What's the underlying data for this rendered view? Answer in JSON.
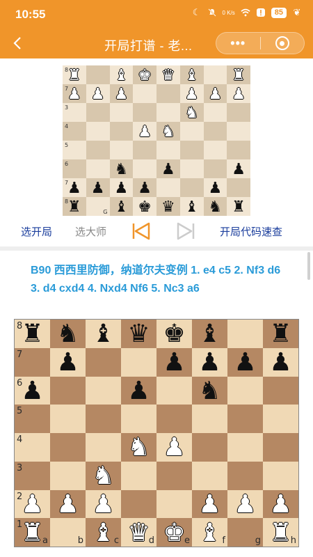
{
  "status_bar": {
    "time": "10:55",
    "net_speed": "0 K/s",
    "battery": "85",
    "icons": [
      "moon-icon",
      "mute-icon",
      "wifi-icon",
      "alert-icon",
      "battery-icon",
      "leaf-icon"
    ]
  },
  "navbar": {
    "title": "开局打谱 - 老...",
    "back_icon": "chevron-left-icon",
    "more_label": "•••",
    "target_icon": "target-icon",
    "background": "#f0952a"
  },
  "toolbar": {
    "select_opening": "选开局",
    "select_master": "选大师",
    "prev_icon": "skip-back-icon",
    "next_icon": "skip-forward-icon",
    "opening_code_lookup": "开局代码速查",
    "accent_prev": "#f0952a"
  },
  "description": "B90 西西里防御，纳道尔夫变例 1. e4 c5 2. Nf3 d6 3. d4 cxd4 4. Nxd4 Nf6 5. Nc3 a6",
  "board_top": {
    "rank_labels": [
      "8",
      "7",
      "3",
      "4",
      "5",
      "6",
      "7",
      "8"
    ],
    "file_label": "G",
    "rows": [
      [
        "wR",
        "",
        "wB",
        "wK",
        "wQ",
        "wB",
        "",
        "wR"
      ],
      [
        "wP",
        "wP",
        "wP",
        "",
        "",
        "wP",
        "wP",
        "wP"
      ],
      [
        "",
        "",
        "",
        "",
        "",
        "wN",
        "",
        ""
      ],
      [
        "",
        "",
        "",
        "wP",
        "wN",
        "",
        "",
        ""
      ],
      [
        "",
        "",
        "",
        "",
        "",
        "",
        "",
        ""
      ],
      [
        "",
        "",
        "bN",
        "",
        "bP",
        "",
        "",
        "bP"
      ],
      [
        "bP",
        "bP",
        "bP",
        "bP",
        "",
        "",
        "bP",
        ""
      ],
      [
        "bR",
        "",
        "bB",
        "bK",
        "bQ",
        "bB",
        "bN",
        "bR"
      ]
    ]
  },
  "board_main": {
    "rank_labels": [
      "8",
      "7",
      "6",
      "5",
      "4",
      "3",
      "2",
      "1"
    ],
    "file_labels": [
      "a",
      "b",
      "c",
      "d",
      "e",
      "f",
      "g",
      "h"
    ],
    "rows": [
      [
        "bR",
        "bN",
        "bB",
        "bQ",
        "bK",
        "bB",
        "",
        "bR"
      ],
      [
        "",
        "bP",
        "",
        "",
        "bP",
        "bP",
        "bP",
        "bP"
      ],
      [
        "bP",
        "",
        "",
        "bP",
        "",
        "bN",
        "",
        ""
      ],
      [
        "",
        "",
        "",
        "",
        "",
        "",
        "",
        ""
      ],
      [
        "",
        "",
        "",
        "wN",
        "wP",
        "",
        "",
        ""
      ],
      [
        "",
        "",
        "wN",
        "",
        "",
        "",
        "",
        ""
      ],
      [
        "wP",
        "wP",
        "wP",
        "",
        "",
        "wP",
        "wP",
        "wP"
      ],
      [
        "wR",
        "",
        "wB",
        "wQ",
        "wK",
        "wB",
        "",
        "wR"
      ]
    ]
  }
}
